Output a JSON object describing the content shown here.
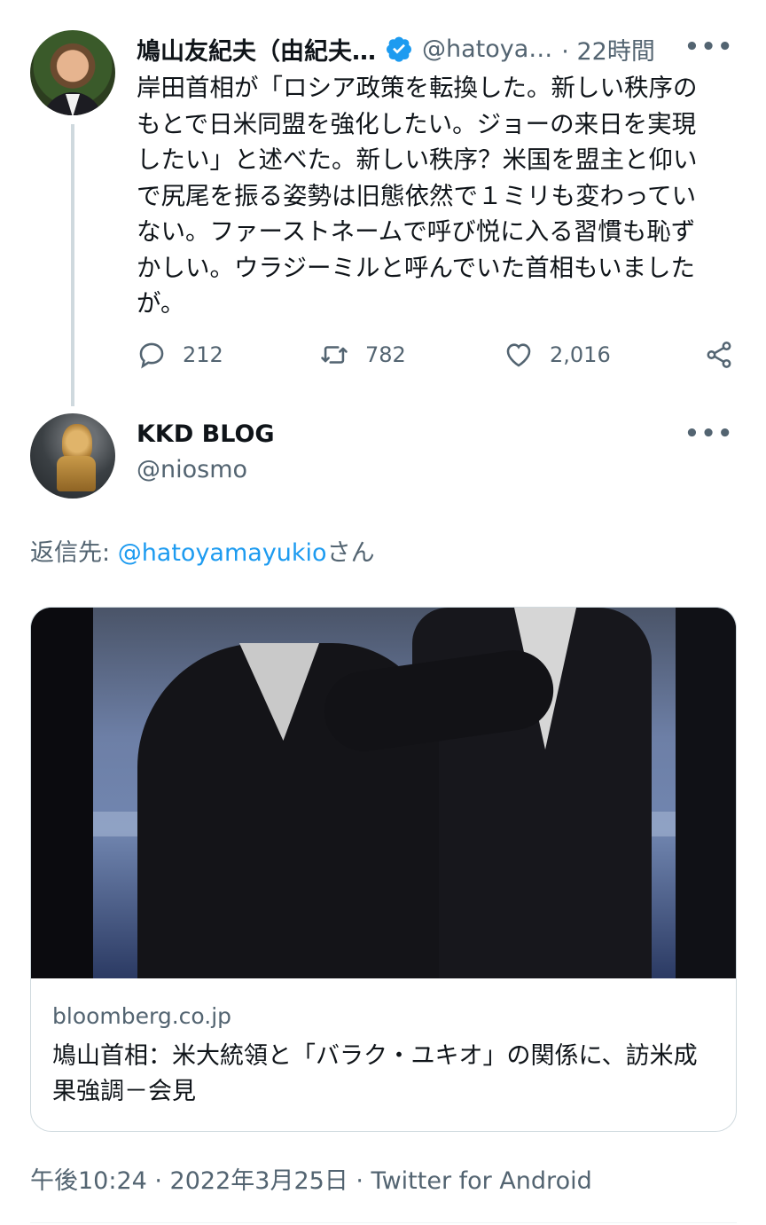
{
  "tweet1": {
    "name": "鳩山友紀夫（由紀夫…",
    "handle": "@hatoya…",
    "time": "· 22時間",
    "text": "岸田首相が「ロシア政策を転換した。新しい秩序の\nもとで日米同盟を強化したい。ジョーの来日を実現\nしたい」と述べた。新しい秩序？米国を盟主と仰い\nで尻尾を振る姿勢は旧態依然で１ミリも変わってい\nない。ファーストネームで呼び悦に入る習慣も恥ず\nかしい。ウラジーミルと呼んでいた首相もいました\nが。",
    "replies": "212",
    "retweets": "782",
    "likes": "2,016",
    "more": "•••"
  },
  "tweet2": {
    "name": "KKD BLOG",
    "handle": "@niosmo",
    "more": "•••",
    "reply_prefix": "返信先: ",
    "reply_mention": "@hatoyamayukio",
    "reply_suffix": "さん",
    "card": {
      "domain": "bloomberg.co.jp",
      "title": "鳩山首相：米大統領と「バラク・ユキオ」の関係に、訪米成果強調－会見"
    },
    "meta": "午後10:24 · 2022年3月25日 · Twitter for Android"
  },
  "colors": {
    "accent": "#1d9bf0",
    "text": "#0f1419",
    "secondary": "#536471",
    "border": "#cfd9de"
  },
  "icons": [
    "verified-badge-icon",
    "reply-icon",
    "retweet-icon",
    "like-icon",
    "share-icon",
    "more-icon"
  ]
}
